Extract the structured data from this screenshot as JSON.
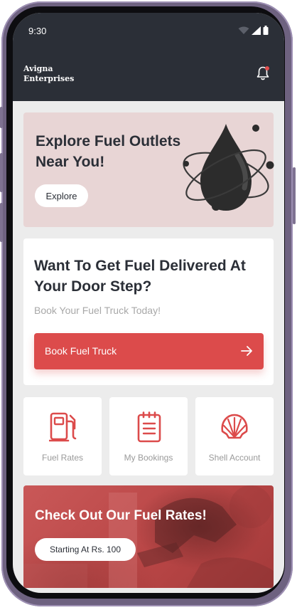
{
  "status_bar": {
    "time": "9:30"
  },
  "header": {
    "brand_line1": "Avigna",
    "brand_line2": "Enterprises",
    "notification_icon": "bell-icon"
  },
  "explore": {
    "title": "Explore Fuel Outlets Near You!",
    "button_label": "Explore"
  },
  "delivery": {
    "title": "Want To Get Fuel Delivered At Your Door Step?",
    "subtitle": "Book Your Fuel Truck Today!",
    "button_label": "Book Fuel Truck",
    "button_icon": "arrow-right-icon"
  },
  "tiles": [
    {
      "label": "Fuel Rates",
      "icon": "fuel-pump-icon"
    },
    {
      "label": "My Bookings",
      "icon": "clipboard-icon"
    },
    {
      "label": "Shell Account",
      "icon": "shell-icon"
    }
  ],
  "rates_banner": {
    "title": "Check Out Our Fuel Rates!",
    "button_label": "Starting At Rs. 100"
  },
  "colors": {
    "header_bg": "#2b2f37",
    "accent_red": "#dc4b4b",
    "explore_bg": "#e8d5d5",
    "page_bg": "#ececec"
  }
}
